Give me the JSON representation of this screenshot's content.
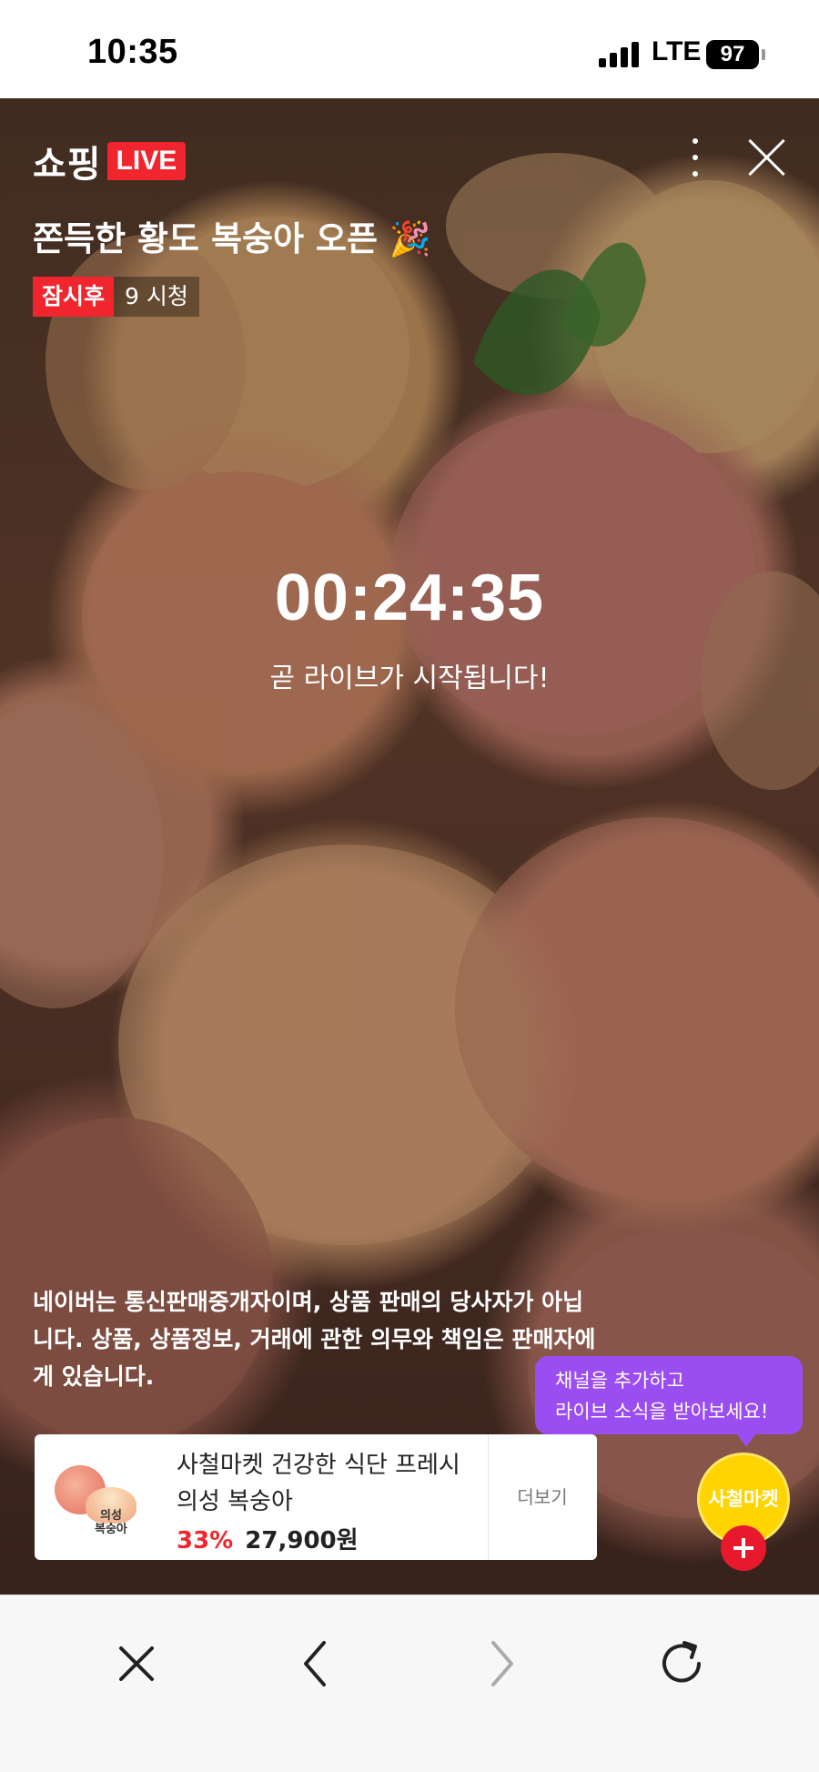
{
  "status_bar": {
    "time": "10:35",
    "network": "LTE",
    "battery": "97"
  },
  "header": {
    "logo_text": "쇼핑",
    "logo_live": "LIVE",
    "title": "쫀득한 황도 복숭아 오픈 🎉",
    "status_badge": "잠시후",
    "viewers": "9 시청"
  },
  "countdown": {
    "time": "00:24:35",
    "message": "곧 라이브가 시작됩니다!"
  },
  "notice": "네이버는 통신판매중개자이며, 상품 판매의 당사자가 아닙니다. 상품, 상품정보, 거래에 관한 의무와 책임은 판매자에게 있습니다.",
  "tooltip": {
    "line1": "채널을 추가하고",
    "line2": "라이브 소식을 받아보세요!"
  },
  "product": {
    "thumb_label_line1": "의성",
    "thumb_label_line2": "복숭아",
    "name": "사철마켓 건강한 식단 프레시 의성 복숭아",
    "discount": "33%",
    "price": "27,900원",
    "more": "더보기"
  },
  "channel": {
    "name": "사철마켓"
  },
  "browser_bar": {
    "icons": [
      "close-icon",
      "back-icon",
      "forward-icon",
      "reload-icon"
    ]
  }
}
